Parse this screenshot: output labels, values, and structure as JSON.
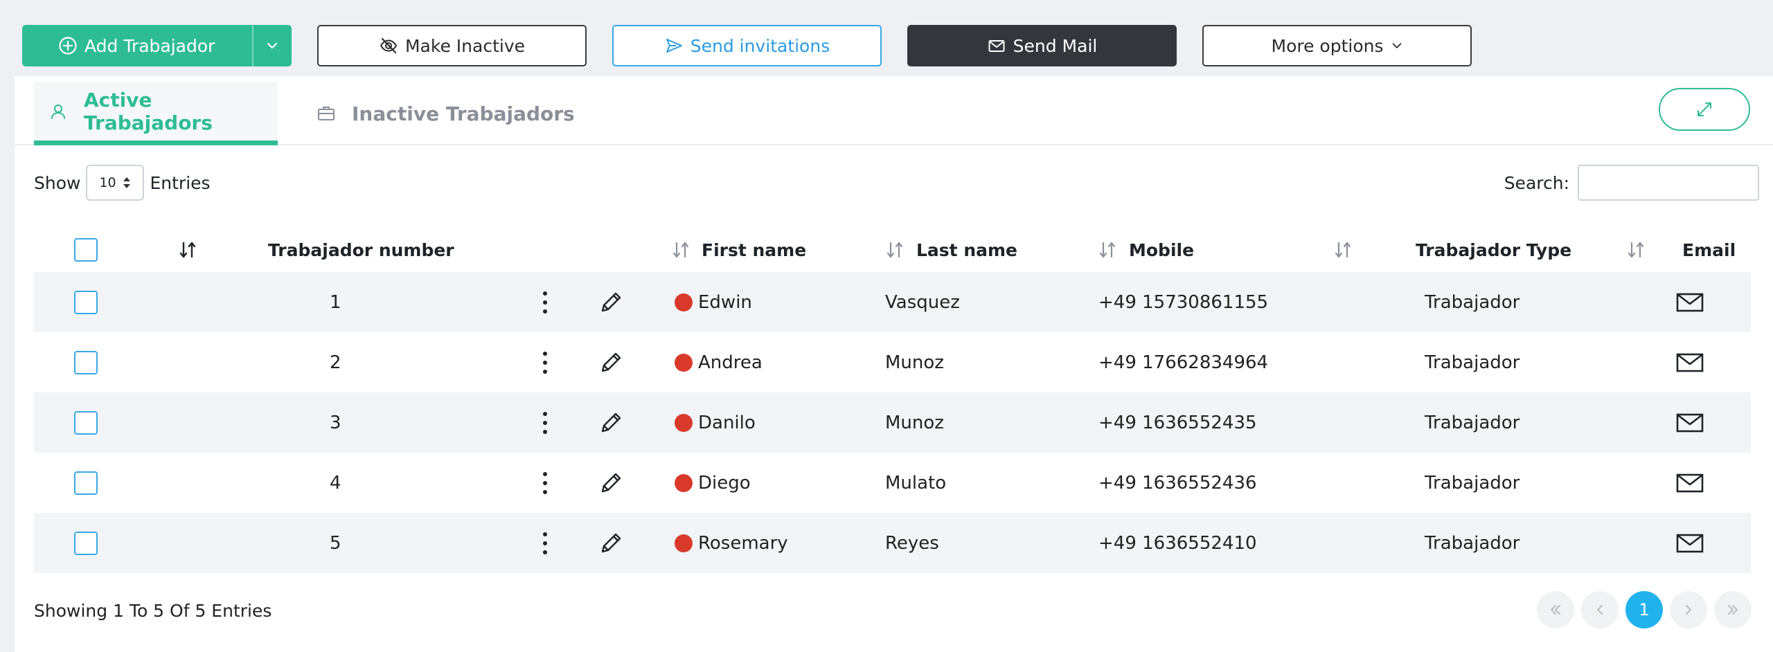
{
  "toolbar": {
    "add_label": "Add Trabajador",
    "make_inactive_label": "Make Inactive",
    "send_invitations_label": "Send invitations",
    "send_mail_label": "Send Mail",
    "more_options_label": "More options"
  },
  "tabs": {
    "active_label": "Active Trabajadors",
    "inactive_label": "Inactive Trabajadors"
  },
  "controls": {
    "show_label": "Show",
    "entries_value": "10",
    "entries_label": "Entries",
    "search_label": "Search:"
  },
  "table": {
    "headers": {
      "number": "Trabajador number",
      "first_name": "First name",
      "last_name": "Last name",
      "mobile": "Mobile",
      "type": "Trabajador Type",
      "email": "Email"
    },
    "rows": [
      {
        "number": "1",
        "first_name": "Edwin",
        "last_name": "Vasquez",
        "mobile": "+49 15730861155",
        "type": "Trabajador"
      },
      {
        "number": "2",
        "first_name": "Andrea",
        "last_name": "Munoz",
        "mobile": "+49 17662834964",
        "type": "Trabajador"
      },
      {
        "number": "3",
        "first_name": "Danilo",
        "last_name": "Munoz",
        "mobile": "+49 1636552435",
        "type": "Trabajador"
      },
      {
        "number": "4",
        "first_name": "Diego",
        "last_name": "Mulato",
        "mobile": "+49 1636552436",
        "type": "Trabajador"
      },
      {
        "number": "5",
        "first_name": "Rosemary",
        "last_name": "Reyes",
        "mobile": "+49 1636552410",
        "type": "Trabajador"
      }
    ]
  },
  "footer": {
    "showing_text": "Showing 1 To 5 Of 5 Entries",
    "current_page": "1"
  },
  "icons": {
    "add": "plus-circle-icon",
    "make_inactive": "eye-off-icon",
    "send_invitations": "send-icon",
    "send_mail": "envelope-icon",
    "more_options": "chevron-down-icon",
    "active_tab": "user-icon",
    "inactive_tab": "briefcase-icon",
    "expand": "expand-icon",
    "row_menu": "vertical-dots-icon",
    "row_edit": "pencil-icon",
    "row_status": "status-dot-icon",
    "row_email": "envelope-icon"
  },
  "colors": {
    "accent": "#2ebc95",
    "info": "#35a8e8",
    "dark": "#33373d",
    "status_inactive": "#d8392b",
    "page_active": "#22b3ee"
  }
}
